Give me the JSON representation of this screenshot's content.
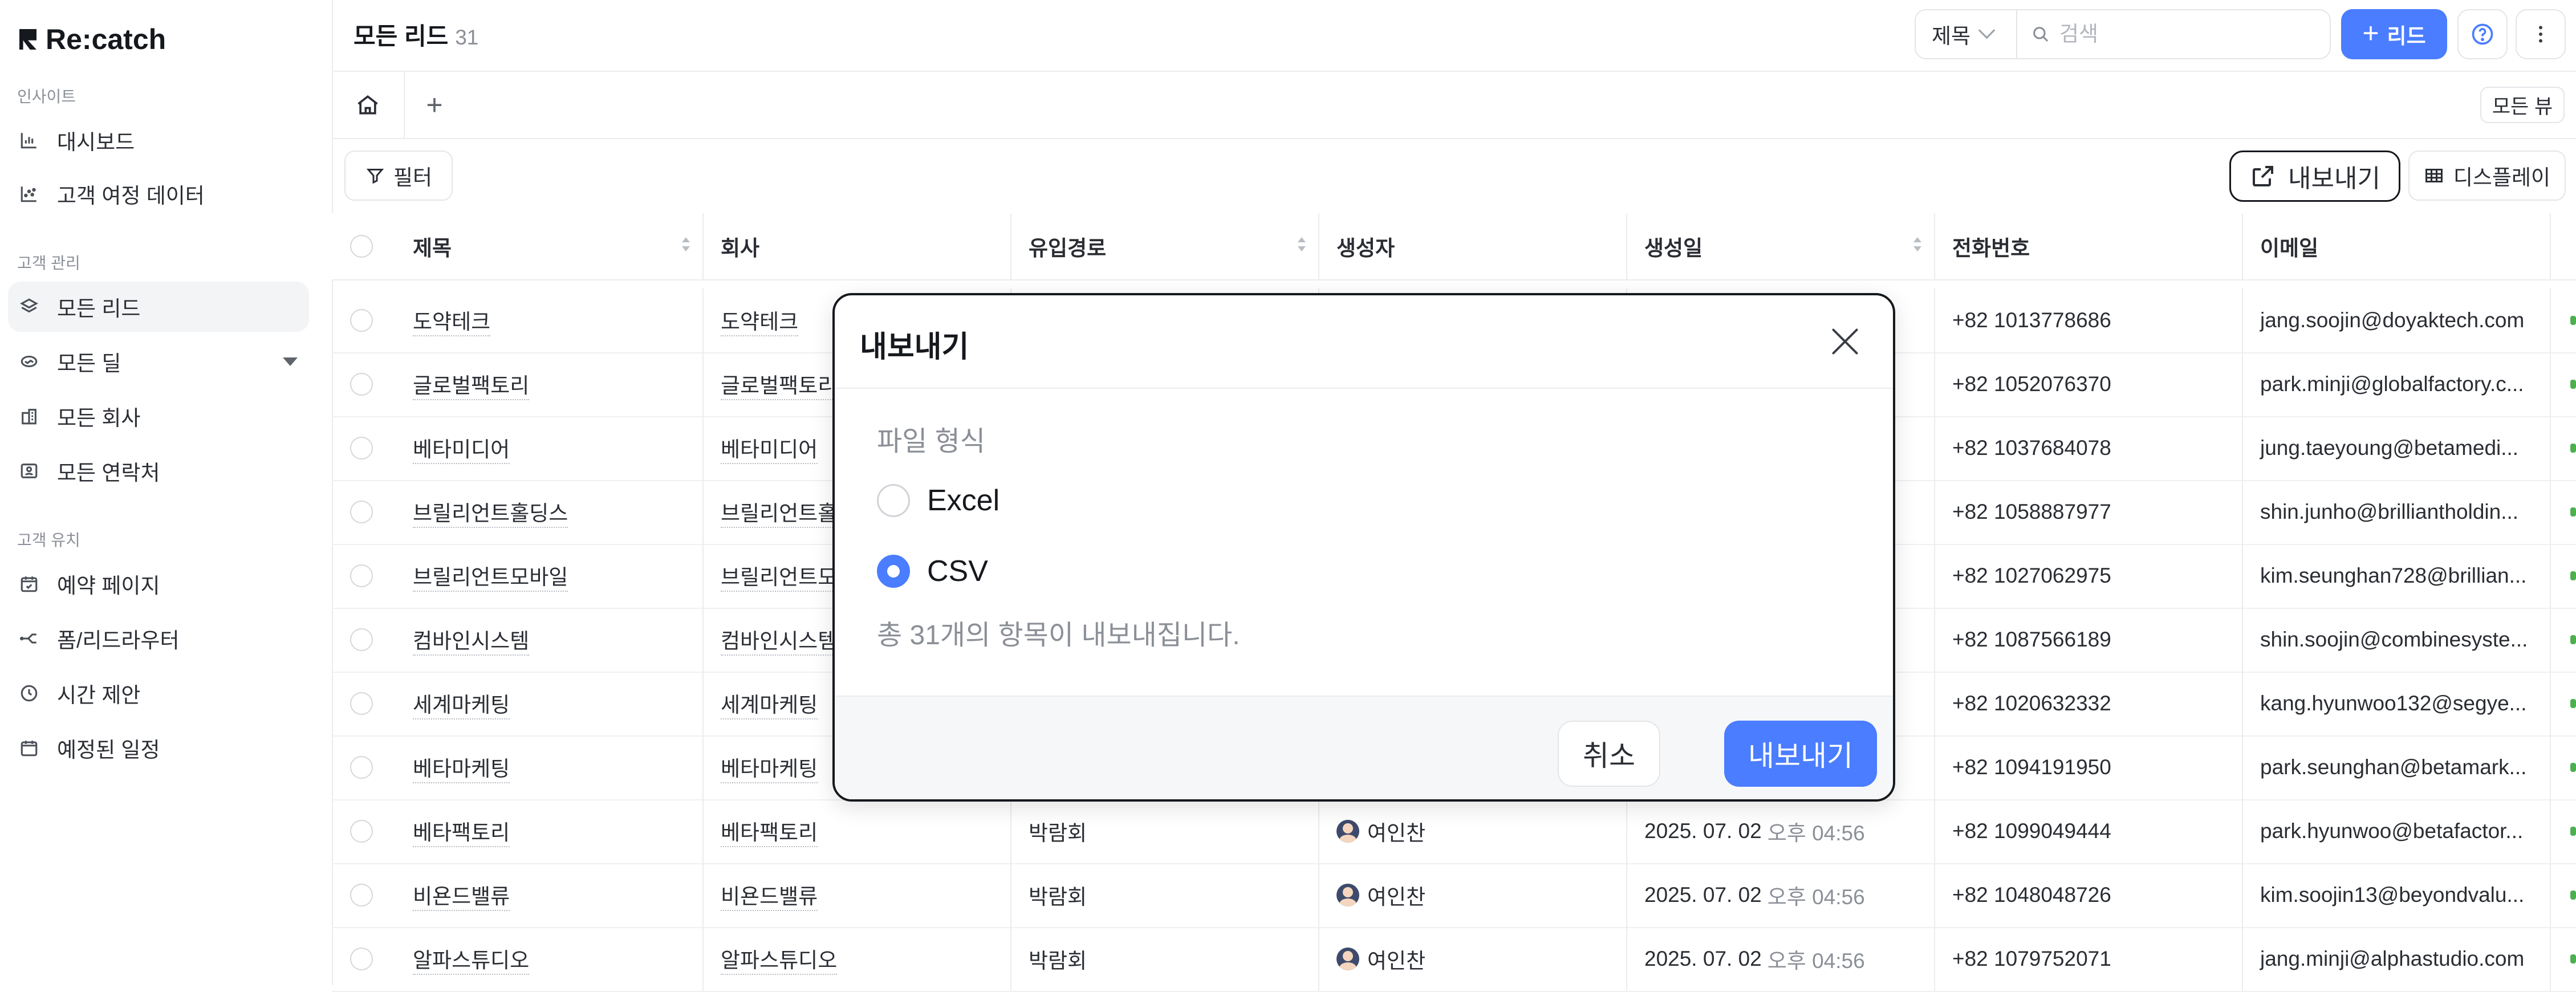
{
  "brand": {
    "name": "Re:catch"
  },
  "sidebar": {
    "sections": [
      {
        "label": "인사이트",
        "items": [
          {
            "label": "대시보드",
            "icon": "bar-chart-icon"
          },
          {
            "label": "고객 여정 데이터",
            "icon": "scatter-chart-icon"
          }
        ]
      },
      {
        "label": "고객 관리",
        "items": [
          {
            "label": "모든 리드",
            "icon": "layers-icon",
            "active": true
          },
          {
            "label": "모든 딜",
            "icon": "handshake-icon"
          },
          {
            "label": "모든 회사",
            "icon": "building-icon"
          },
          {
            "label": "모든 연락처",
            "icon": "contact-card-icon"
          }
        ]
      },
      {
        "label": "고객 유치",
        "items": [
          {
            "label": "예약 페이지",
            "icon": "calendar-check-icon"
          },
          {
            "label": "폼/리드라우터",
            "icon": "router-icon"
          },
          {
            "label": "시간 제안",
            "icon": "clock-icon"
          },
          {
            "label": "예정된 일정",
            "icon": "calendar-icon"
          }
        ]
      }
    ]
  },
  "header": {
    "title": "모든 리드",
    "count": "31",
    "field_select": "제목",
    "search_placeholder": "검색",
    "add_button": "리드",
    "add_icon": "+"
  },
  "viewbar": {
    "add_tab": "+",
    "all_views": "모든 뷰"
  },
  "toolbar": {
    "filter": "필터",
    "export": "내보내기",
    "display": "디스플레이"
  },
  "table": {
    "columns": [
      "제목",
      "회사",
      "유입경로",
      "생성자",
      "생성일",
      "전화번호",
      "이메일"
    ],
    "rows": [
      {
        "title": "도약테크",
        "company": "도약테크",
        "source": "",
        "creator": "",
        "date": "",
        "time": "",
        "phone": "+82 1013778686",
        "email": "jang.soojin@doyaktech.com"
      },
      {
        "title": "글로벌팩토리",
        "company": "글로벌팩토리",
        "source": "",
        "creator": "",
        "date": "",
        "time": "",
        "phone": "+82 1052076370",
        "email": "park.minji@globalfactory.c..."
      },
      {
        "title": "베타미디어",
        "company": "베타미디어",
        "source": "",
        "creator": "",
        "date": "",
        "time": "",
        "phone": "+82 1037684078",
        "email": "jung.taeyoung@betamedi..."
      },
      {
        "title": "브릴리언트홀딩스",
        "company": "브릴리언트홀",
        "source": "",
        "creator": "",
        "date": "",
        "time": "",
        "phone": "+82 1058887977",
        "email": "shin.junho@brilliantholdin..."
      },
      {
        "title": "브릴리언트모바일",
        "company": "브릴리언트모",
        "source": "",
        "creator": "",
        "date": "",
        "time": "",
        "phone": "+82 1027062975",
        "email": "kim.seunghan728@brillian..."
      },
      {
        "title": "컴바인시스템",
        "company": "컴바인시스템",
        "source": "",
        "creator": "",
        "date": "",
        "time": "",
        "phone": "+82 1087566189",
        "email": "shin.soojin@combinesyste..."
      },
      {
        "title": "세계마케팅",
        "company": "세계마케팅",
        "source": "",
        "creator": "",
        "date": "",
        "time": "",
        "phone": "+82 1020632332",
        "email": "kang.hyunwoo132@segye..."
      },
      {
        "title": "베타마케팅",
        "company": "베타마케팅",
        "source": "",
        "creator": "",
        "date": "",
        "time": "",
        "phone": "+82 1094191950",
        "email": "park.seunghan@betamark..."
      },
      {
        "title": "베타팩토리",
        "company": "베타팩토리",
        "source": "박람회",
        "creator": "여인찬",
        "date": "2025. 07. 02",
        "time": "오후 04:56",
        "phone": "+82 1099049444",
        "email": "park.hyunwoo@betafactor..."
      },
      {
        "title": "비욘드밸류",
        "company": "비욘드밸류",
        "source": "박람회",
        "creator": "여인찬",
        "date": "2025. 07. 02",
        "time": "오후 04:56",
        "phone": "+82 1048048726",
        "email": "kim.soojin13@beyondvalu..."
      },
      {
        "title": "알파스튜디오",
        "company": "알파스튜디오",
        "source": "박람회",
        "creator": "여인찬",
        "date": "2025. 07. 02",
        "time": "오후 04:56",
        "phone": "+82 1079752071",
        "email": "jang.minji@alphastudio.com"
      }
    ]
  },
  "dialog": {
    "title": "내보내기",
    "format_label": "파일 형식",
    "options": [
      {
        "label": "Excel",
        "selected": false
      },
      {
        "label": "CSV",
        "selected": true
      }
    ],
    "note": "총 31개의 항목이 내보내집니다.",
    "cancel": "취소",
    "confirm": "내보내기"
  },
  "colors": {
    "accent": "#4a7dff",
    "text": "#1f2328",
    "muted": "#8b8f97",
    "border": "#ececec"
  }
}
